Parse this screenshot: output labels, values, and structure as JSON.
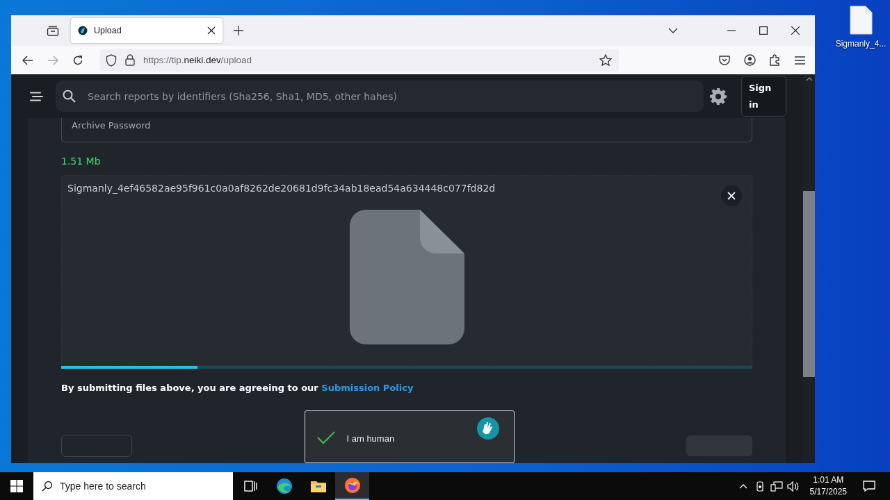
{
  "window": {
    "tab": {
      "title": "Upload",
      "selected": true
    },
    "url": {
      "scheme": "https://tip.",
      "domain": "neiki.dev",
      "path": "/upload"
    }
  },
  "page": {
    "search": {
      "placeholder": "Search reports by identifiers (Sha256, Sha1, MD5, other hahes)"
    },
    "sign_in": "Sign in",
    "archive_password": {
      "placeholder": "Archive Password"
    },
    "file_size": "1.51 Mb",
    "file": {
      "name": "Sigmanly_4ef46582ae95f961c0a0af8262de20681d9fc34ab18ead54a634448c077fd82d",
      "progress": {
        "level": 0.197
      }
    },
    "policy": {
      "text": "By submitting files above, you are agreeing to our",
      "link": "Submission Policy"
    },
    "captcha": {
      "label": "I am human",
      "checked": true
    }
  },
  "desktop": {
    "icons": [
      {
        "label": "Sigmanly_4..."
      }
    ]
  },
  "taskbar": {
    "search": {
      "placeholder": "Type here to search"
    },
    "apps": [
      {
        "kind": "task-view",
        "selected": false
      },
      {
        "kind": "edge",
        "selected": false
      },
      {
        "kind": "explorer",
        "selected": false
      },
      {
        "kind": "firefox",
        "selected": true
      }
    ],
    "time": "1:01 AM",
    "date": "5/17/2025"
  }
}
